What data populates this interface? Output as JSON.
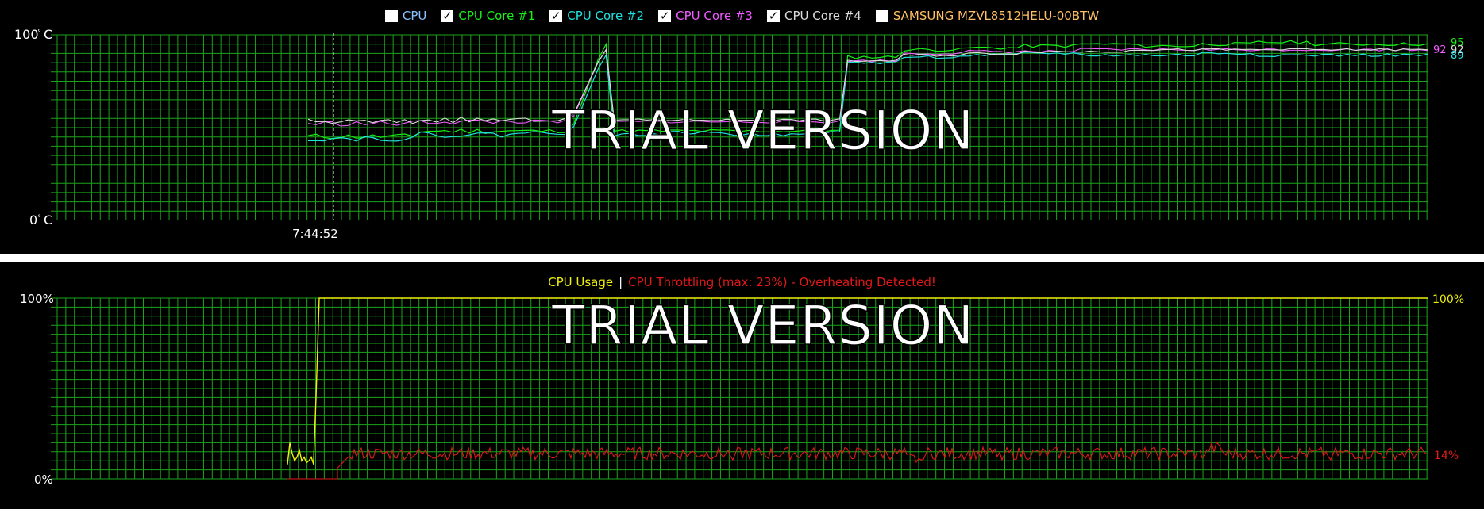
{
  "legend": {
    "items": [
      {
        "label": "CPU",
        "checked": false,
        "check_mark": "",
        "color": "#89c3ff"
      },
      {
        "label": "CPU Core #1",
        "checked": true,
        "check_mark": "✓",
        "color": "#16f016"
      },
      {
        "label": "CPU Core #2",
        "checked": true,
        "check_mark": "✓",
        "color": "#22e1e1"
      },
      {
        "label": "CPU Core #3",
        "checked": true,
        "check_mark": "✓",
        "color": "#ef5cff"
      },
      {
        "label": "CPU Core #4",
        "checked": true,
        "check_mark": "✓",
        "color": "#dcdcdc"
      },
      {
        "label": "SAMSUNG MZVL8512HELU-00BTW",
        "checked": false,
        "check_mark": "",
        "color": "#ffbf66"
      }
    ]
  },
  "top_chart": {
    "y_max_label": "100",
    "y_min_label": "0",
    "unit_degree": "°",
    "unit_c": "C",
    "time_label": "7:44:52",
    "watermark": "TRIAL VERSION",
    "end_values": {
      "core1": "95",
      "core2": "89",
      "core3": "92",
      "core4": "92"
    }
  },
  "bottom_chart": {
    "usage_label": "CPU Usage",
    "separator": "|",
    "throttle_label": "CPU Throttling (max: 23%) - Overheating Detected!",
    "y_max_label": "100%",
    "y_min_label": "0%",
    "watermark": "TRIAL VERSION",
    "right_usage_label": "100%",
    "right_throttle_label": "14%"
  },
  "colors": {
    "grid": "#1aa41a",
    "core1": "#16f016",
    "core2": "#22e1e1",
    "core3": "#ef5cff",
    "core4": "#dcdcdc",
    "usage": "#eef00e",
    "throttle": "#e31818",
    "text": "#ffffff"
  },
  "chart_data": [
    {
      "type": "line",
      "x_axis_label": "7:44:52",
      "ylim": [
        0,
        100
      ],
      "series": [
        {
          "name": "CPU Core #1",
          "values": [
            48,
            48,
            48,
            48,
            88,
            92,
            93,
            94,
            95,
            94,
            95,
            96,
            95,
            95,
            95
          ]
        },
        {
          "name": "CPU Core #2",
          "values": [
            46,
            47,
            46,
            47,
            85,
            88,
            89,
            90,
            89,
            89,
            90,
            89,
            89,
            89,
            89
          ]
        },
        {
          "name": "CPU Core #3",
          "values": [
            53,
            53,
            53,
            53,
            86,
            90,
            91,
            91,
            92,
            92,
            92,
            92,
            92,
            92,
            92
          ]
        },
        {
          "name": "CPU Core #4",
          "values": [
            54,
            54,
            54,
            54,
            86,
            89,
            90,
            91,
            91,
            92,
            92,
            92,
            92,
            92,
            92
          ]
        }
      ]
    },
    {
      "type": "line",
      "ylim": [
        0,
        100
      ],
      "series": [
        {
          "name": "CPU Usage",
          "values": [
            12,
            18,
            10,
            12,
            100,
            100,
            100,
            100,
            100,
            100,
            100,
            100,
            100,
            100,
            100
          ]
        },
        {
          "name": "CPU Throttling",
          "values": [
            0,
            0,
            0,
            0,
            0,
            13,
            16,
            15,
            16,
            14,
            17,
            15,
            16,
            14,
            14
          ]
        }
      ]
    }
  ]
}
